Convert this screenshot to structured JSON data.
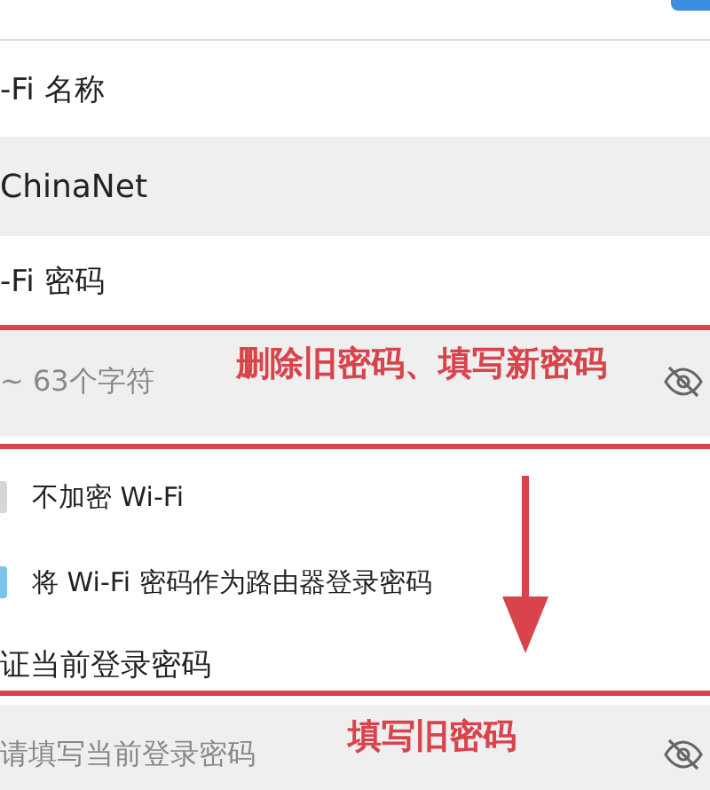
{
  "name_label": "-Fi 名称",
  "name_field": {
    "value": "ChinaNet"
  },
  "password_label": "-Fi 密码",
  "password_field": {
    "placeholder": "~ 63个字符",
    "annotation": "删除旧密码、填写新密码"
  },
  "options": [
    {
      "label": "不加密 Wi-Fi",
      "checked": false
    },
    {
      "label": "将 Wi-Fi 密码作为路由器登录密码",
      "checked": true
    }
  ],
  "verify_label": "证当前登录密码",
  "verify_field": {
    "placeholder": "请填写当前登录密码",
    "annotation": "填写旧密码"
  }
}
